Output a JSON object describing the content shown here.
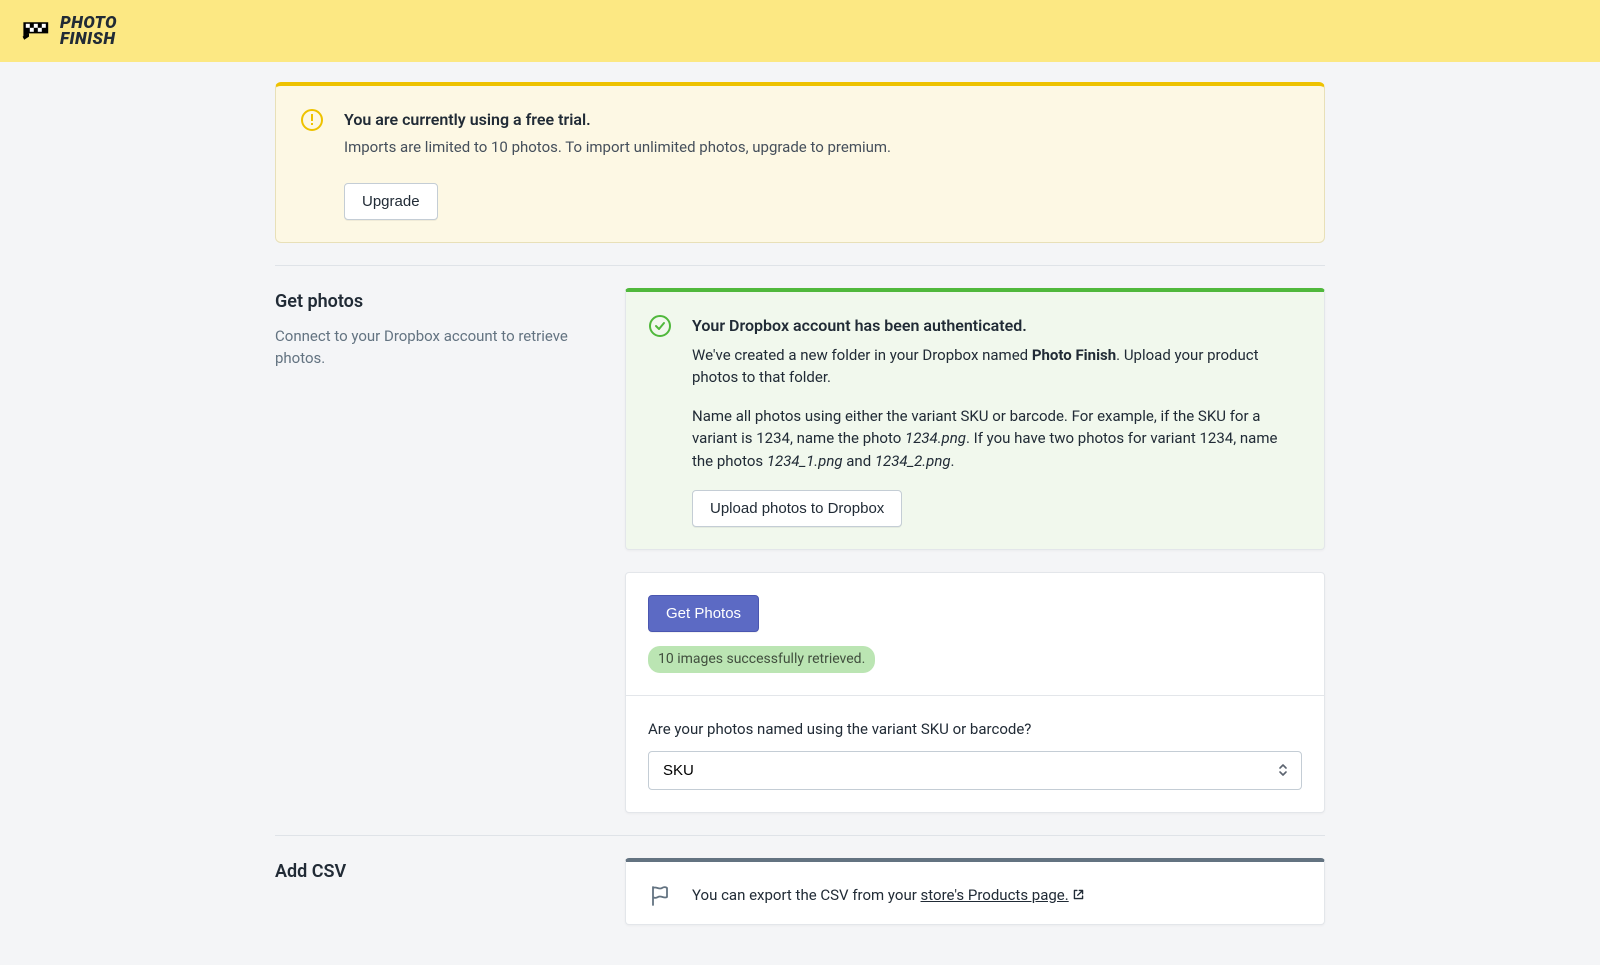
{
  "logo": {
    "line1": "PHOTO",
    "line2": "FINISH"
  },
  "trial_banner": {
    "title": "You are currently using a free trial.",
    "description": "Imports are limited to 10 photos. To import unlimited photos, upgrade to premium.",
    "button": "Upgrade"
  },
  "get_photos": {
    "heading": "Get photos",
    "subtext": "Connect to your Dropbox account to retrieve photos.",
    "auth_card": {
      "title": "Your Dropbox account has been authenticated.",
      "desc_prefix": "We've created a new folder in your Dropbox named ",
      "folder_name": "Photo Finish",
      "desc_suffix": ". Upload your product photos to that folder.",
      "naming_prefix": "Name all photos using either the variant SKU or barcode. For example, if the SKU for a variant is 1234, name the photo ",
      "ex1": "1234.png",
      "naming_middle": ". If you have two photos for variant 1234, name the photos ",
      "ex2": "1234_1.png",
      "and": " and ",
      "ex3": "1234_2.png",
      "naming_suffix": ".",
      "upload_button": "Upload photos to Dropbox"
    },
    "action_card": {
      "button": "Get Photos",
      "status": "10 images successfully retrieved.",
      "select_label": "Are your photos named using the variant SKU or barcode?",
      "select_value": "SKU"
    }
  },
  "add_csv": {
    "heading": "Add CSV",
    "card": {
      "text_prefix": "You can export the CSV from your ",
      "link_text": "store's Products page."
    }
  }
}
